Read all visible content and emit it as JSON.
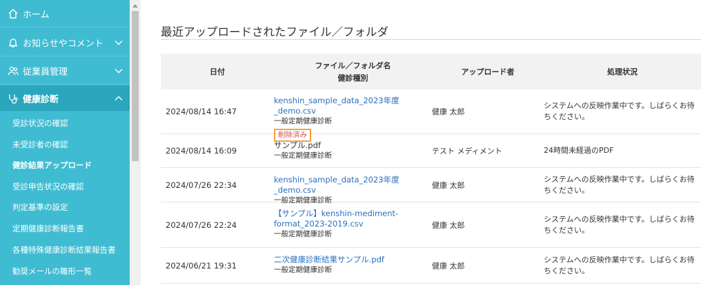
{
  "sidebar": {
    "items": [
      {
        "label": "ホーム",
        "icon": "home-icon"
      },
      {
        "label": "お知らせやコメント",
        "icon": "bell-icon"
      },
      {
        "label": "従業員管理",
        "icon": "users-icon"
      },
      {
        "label": "健康診断",
        "icon": "stethoscope-icon"
      }
    ],
    "subitems": [
      "受診状況の確認",
      "未受診者の確認",
      "健診結果アップロード",
      "受診申告状況の確認",
      "判定基準の設定",
      "定期健康診断報告書",
      "各種特殊健康診断結果報告書",
      "勧奨メールの雛形一覧"
    ]
  },
  "main": {
    "title": "最近アップロードされたファイル／フォルダ",
    "table": {
      "headers": {
        "date": "日付",
        "file": "ファイル／フォルダ名",
        "kind": "健診種別",
        "uploader": "アップロード者",
        "status": "処理状況"
      },
      "rows": [
        {
          "date": "2024/08/14 16:47",
          "file": "kenshin_sample_data_2023年度_demo.csv",
          "kind": "一般定期健康診断",
          "badge": "削除済み",
          "uploader": "健康 太郎",
          "status": "システムへの反映作業中です。しばらくお待ちください。"
        },
        {
          "date": "2024/08/14 16:09",
          "file": "サンプル.pdf",
          "kind": "一般定期健康診断",
          "uploader": "テスト メディメント",
          "status": "24時間未経過のPDF"
        },
        {
          "date": "2024/07/26 22:34",
          "file": "kenshin_sample_data_2023年度_demo.csv",
          "kind": "一般定期健康診断",
          "uploader": "健康 太郎",
          "status": "システムへの反映作業中です。しばらくお待ちください。"
        },
        {
          "date": "2024/07/26 22:24",
          "file_line1": "【サンプル】kenshin-mediment-",
          "file_line2": "format_2023-2019.csv",
          "kind": "一般定期健康診断",
          "uploader": "健康 太郎",
          "status": "システムへの反映作業中です。しばらくお待ちください。"
        },
        {
          "date": "2024/06/21 19:31",
          "file": "二次健康診断結果サンプル.pdf",
          "kind": "一般定期健康診断",
          "uploader": "健康 太郎",
          "status": "システムへの反映作業中です。しばらくお待ちください。"
        }
      ]
    }
  },
  "colors": {
    "sidebar_bg": "#3fbcd2",
    "sidebar_active": "#2aa6bd",
    "link": "#2a6fbf",
    "deleted_border": "#f5a13a",
    "deleted_text": "#d9534f"
  }
}
